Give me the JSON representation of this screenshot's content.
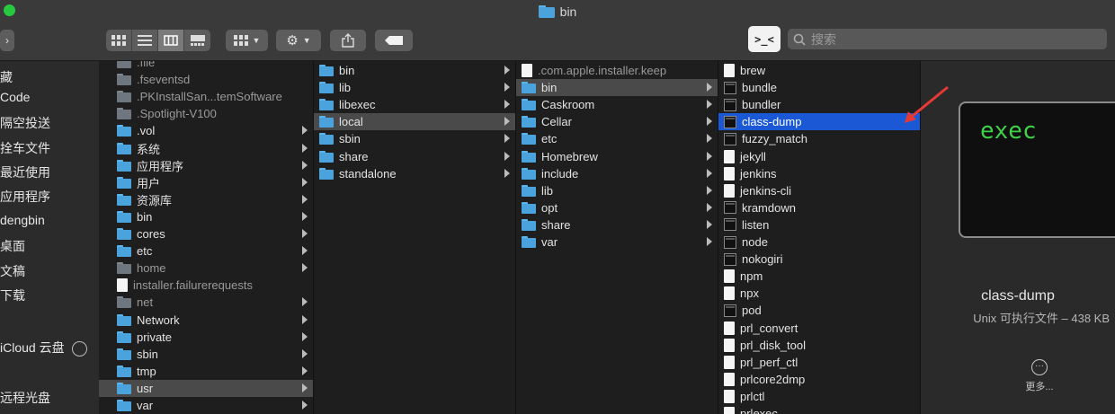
{
  "window": {
    "title": "bin"
  },
  "toolbar": {
    "search_placeholder": "搜索",
    "terminal_label": ">_<"
  },
  "sidebar": {
    "items": [
      "藏",
      "Code",
      "隔空投送",
      "拴车文件",
      "最近使用",
      "应用程序",
      "dengbin",
      "桌面",
      "文稿",
      "下载",
      "iCloud 云盘",
      "远程光盘"
    ]
  },
  "col1": {
    "items": [
      {
        "name": ".file",
        "type": "folder-gray",
        "chev": false
      },
      {
        "name": ".fseventsd",
        "type": "folder-gray",
        "chev": false
      },
      {
        "name": ".PKInstallSan...temSoftware",
        "type": "folder-gray",
        "chev": false
      },
      {
        "name": ".Spotlight-V100",
        "type": "folder-gray",
        "chev": false
      },
      {
        "name": ".vol",
        "type": "folder",
        "chev": true
      },
      {
        "name": "系统",
        "type": "folder",
        "chev": true
      },
      {
        "name": "应用程序",
        "type": "folder",
        "chev": true
      },
      {
        "name": "用户",
        "type": "folder",
        "chev": true
      },
      {
        "name": "资源库",
        "type": "folder",
        "chev": true
      },
      {
        "name": "bin",
        "type": "folder",
        "chev": true
      },
      {
        "name": "cores",
        "type": "folder",
        "chev": true
      },
      {
        "name": "etc",
        "type": "folder",
        "chev": true
      },
      {
        "name": "home",
        "type": "folder-gray",
        "chev": true
      },
      {
        "name": "installer.failurerequests",
        "type": "doc",
        "chev": false
      },
      {
        "name": "net",
        "type": "folder-gray",
        "chev": true
      },
      {
        "name": "Network",
        "type": "folder",
        "chev": true
      },
      {
        "name": "private",
        "type": "folder",
        "chev": true
      },
      {
        "name": "sbin",
        "type": "folder",
        "chev": true
      },
      {
        "name": "tmp",
        "type": "folder",
        "chev": true
      },
      {
        "name": "usr",
        "type": "folder",
        "chev": true,
        "selected": true
      },
      {
        "name": "var",
        "type": "folder",
        "chev": true
      }
    ]
  },
  "col2": {
    "items": [
      {
        "name": "bin",
        "chev": true
      },
      {
        "name": "lib",
        "chev": true
      },
      {
        "name": "libexec",
        "chev": true
      },
      {
        "name": "local",
        "chev": true,
        "selected": true
      },
      {
        "name": "sbin",
        "chev": true
      },
      {
        "name": "share",
        "chev": true
      },
      {
        "name": "standalone",
        "chev": true
      }
    ]
  },
  "col3": {
    "items": [
      {
        "name": ".com.apple.installer.keep",
        "type": "doc",
        "chev": false
      },
      {
        "name": "bin",
        "type": "folder",
        "chev": true,
        "selected": true
      },
      {
        "name": "Caskroom",
        "type": "folder",
        "chev": true
      },
      {
        "name": "Cellar",
        "type": "folder",
        "chev": true
      },
      {
        "name": "etc",
        "type": "folder",
        "chev": true
      },
      {
        "name": "Homebrew",
        "type": "folder",
        "chev": true
      },
      {
        "name": "include",
        "type": "folder",
        "chev": true
      },
      {
        "name": "lib",
        "type": "folder",
        "chev": true
      },
      {
        "name": "opt",
        "type": "folder",
        "chev": true
      },
      {
        "name": "share",
        "type": "folder",
        "chev": true
      },
      {
        "name": "var",
        "type": "folder",
        "chev": true
      }
    ]
  },
  "col4": {
    "items": [
      {
        "name": "brew",
        "type": "doc"
      },
      {
        "name": "bundle",
        "type": "exec"
      },
      {
        "name": "bundler",
        "type": "exec"
      },
      {
        "name": "class-dump",
        "type": "exec",
        "selected": true
      },
      {
        "name": "fuzzy_match",
        "type": "exec"
      },
      {
        "name": "jekyll",
        "type": "doc"
      },
      {
        "name": "jenkins",
        "type": "doc"
      },
      {
        "name": "jenkins-cli",
        "type": "doc"
      },
      {
        "name": "kramdown",
        "type": "exec"
      },
      {
        "name": "listen",
        "type": "exec"
      },
      {
        "name": "node",
        "type": "exec"
      },
      {
        "name": "nokogiri",
        "type": "exec"
      },
      {
        "name": "npm",
        "type": "doc"
      },
      {
        "name": "npx",
        "type": "doc"
      },
      {
        "name": "pod",
        "type": "exec"
      },
      {
        "name": "prl_convert",
        "type": "doc"
      },
      {
        "name": "prl_disk_tool",
        "type": "doc"
      },
      {
        "name": "prl_perf_ctl",
        "type": "doc"
      },
      {
        "name": "prlcore2dmp",
        "type": "doc"
      },
      {
        "name": "prlctl",
        "type": "doc"
      },
      {
        "name": "prlexec",
        "type": "doc"
      }
    ]
  },
  "preview": {
    "icon_text": "exec",
    "name": "class-dump",
    "kind": "Unix 可执行文件 – 438 KB",
    "more_label": "更多..."
  },
  "colors": {
    "selection_blue": "#1a58d6",
    "folder_blue": "#4aa3dd",
    "exec_green": "#3fd14a",
    "arrow_red": "#e53935"
  }
}
